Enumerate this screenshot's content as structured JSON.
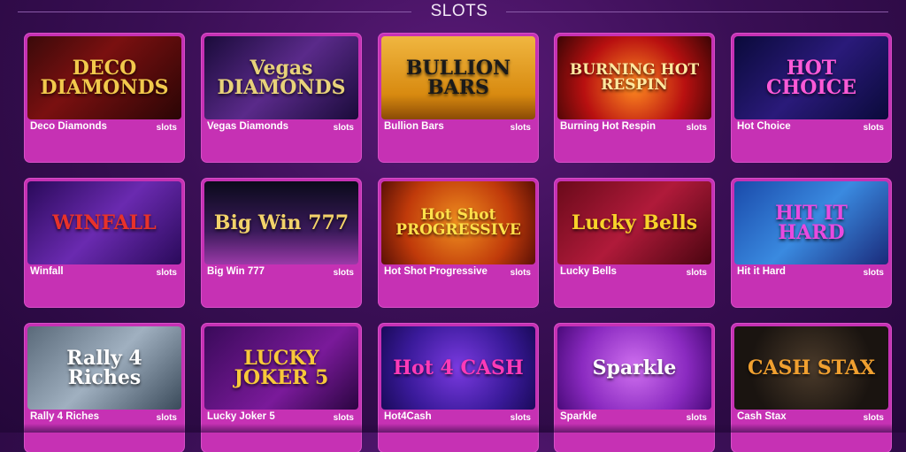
{
  "section_title": "SLOTS",
  "games": [
    {
      "name": "Deco Diamonds",
      "category": "slots",
      "art": "DECO DIAMONDS",
      "bg": "linear-gradient(135deg,#3a0a0a,#7a1010 40%,#2a0505)",
      "fg": "#f2c94c"
    },
    {
      "name": "Vegas Diamonds",
      "category": "slots",
      "art": "Vegas DIAMONDS",
      "bg": "linear-gradient(135deg,#1a0b3a,#5a2a8a 50%,#1a0b3a)",
      "fg": "#e8d27a"
    },
    {
      "name": "Bullion Bars",
      "category": "slots",
      "art": "BULLION BARS",
      "bg": "linear-gradient(180deg,#f0b640,#d88a10 70%,#8a4a05)",
      "fg": "#1a1a1a"
    },
    {
      "name": "Burning Hot Respin",
      "category": "slots",
      "art": "BURNING HOT RESPIN",
      "bg": "radial-gradient(circle at 50% 60%,#ff8a20,#b81010 55%,#3a0505)",
      "fg": "#ffe9a0"
    },
    {
      "name": "Hot Choice",
      "category": "slots",
      "art": "HOT CHOICE",
      "bg": "linear-gradient(135deg,#0a0a3a,#2a1a7a 50%,#0a0a3a)",
      "fg": "#ff5ad8"
    },
    {
      "name": "Winfall",
      "category": "slots",
      "art": "WINFALL",
      "bg": "linear-gradient(135deg,#2a0a5a,#6a2ab0 50%,#2a0a5a)",
      "fg": "#e8322a"
    },
    {
      "name": "Big Win 777",
      "category": "slots",
      "art": "Big Win 777",
      "bg": "linear-gradient(180deg,#0a0a1a,#3a1a5a 60%,#9a3aa8)",
      "fg": "#f2d26a"
    },
    {
      "name": "Hot Shot Progressive",
      "category": "slots",
      "art": "Hot Shot PROGRESSIVE",
      "bg": "radial-gradient(circle,#f09020,#c03a0a 60%,#5a1005)",
      "fg": "#ffe14a"
    },
    {
      "name": "Lucky Bells",
      "category": "slots",
      "art": "Lucky Bells",
      "bg": "linear-gradient(135deg,#6a0a1a,#b01a3a 50%,#4a0510)",
      "fg": "#f8d22a"
    },
    {
      "name": "Hit it Hard",
      "category": "slots",
      "art": "HIT IT HARD",
      "bg": "linear-gradient(135deg,#1a4aaa,#3a8ae0 50%,#1a2a7a)",
      "fg": "#e84ae0"
    },
    {
      "name": "Rally 4 Riches",
      "category": "slots",
      "art": "Rally 4 Riches",
      "bg": "linear-gradient(135deg,#5a6a7a,#a0b0c0 50%,#3a4a5a)",
      "fg": "#ffffff"
    },
    {
      "name": "Lucky Joker 5",
      "category": "slots",
      "art": "LUCKY JOKER 5",
      "bg": "linear-gradient(135deg,#3a0a5a,#7a1a9a 60%,#2a0540)",
      "fg": "#f8c83a"
    },
    {
      "name": "Hot4Cash",
      "category": "slots",
      "art": "Hot 4 CASH",
      "bg": "radial-gradient(circle,#7a3ae0,#3a1a9a 60%,#1a0a5a)",
      "fg": "#ff3ab8"
    },
    {
      "name": "Sparkle",
      "category": "slots",
      "art": "Sparkle",
      "bg": "radial-gradient(circle,#d070f0,#8a2ac0 60%,#4a0a7a)",
      "fg": "#ffffff"
    },
    {
      "name": "Cash Stax",
      "category": "slots",
      "art": "CASH STAX",
      "bg": "radial-gradient(circle,#4a3a2a,#1a1410 70%)",
      "fg": "#f0a030"
    }
  ]
}
